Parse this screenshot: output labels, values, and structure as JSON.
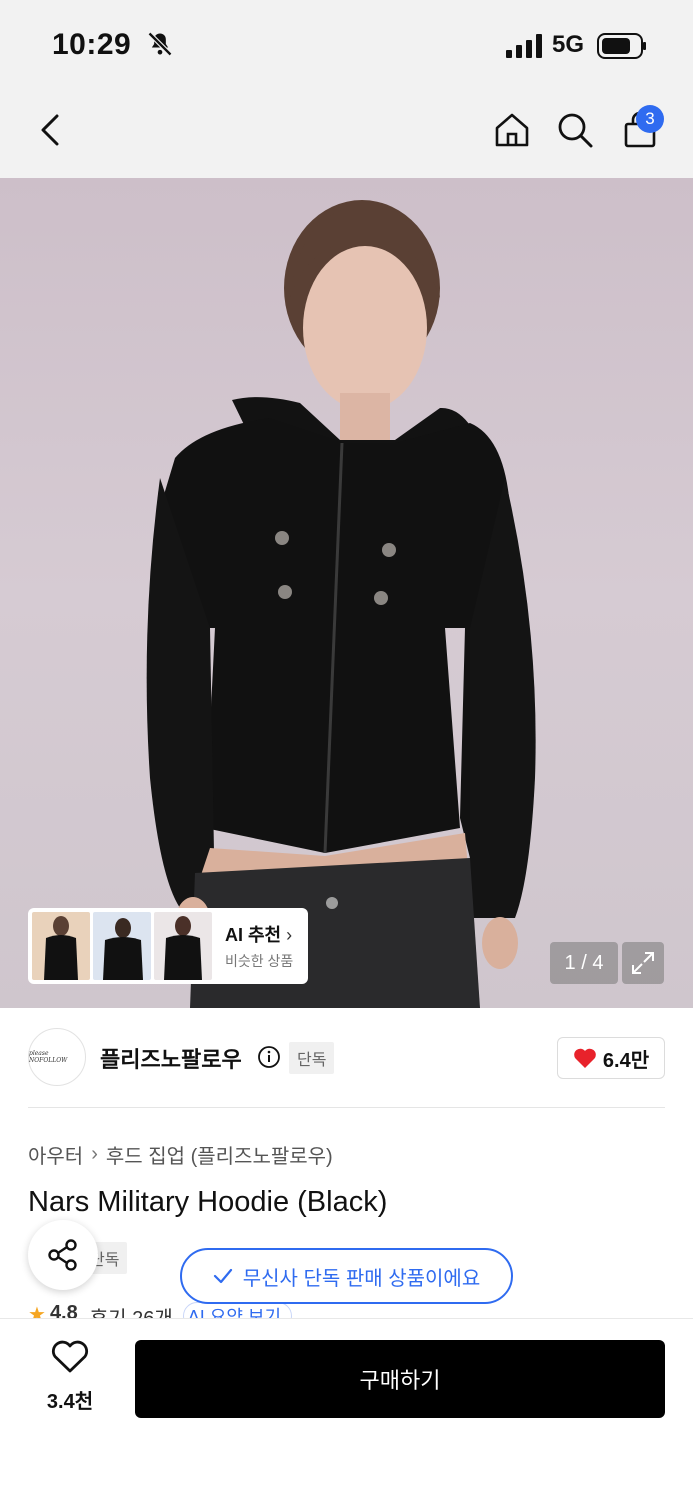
{
  "status_bar": {
    "time": "10:29",
    "network": "5G"
  },
  "nav": {
    "cart_count": "3"
  },
  "hero": {
    "image_counter": "1 / 4"
  },
  "ai_recommend": {
    "title": "AI 추천",
    "subtitle": "비슷한 상품"
  },
  "brand": {
    "name": "플리즈노팔로우",
    "tag": "단독",
    "likes": "6.4만",
    "logo_text": "please NOFOLLOW"
  },
  "breadcrumb": {
    "category": "아우터",
    "subcategory": "후드 집업 (플리즈노팔로우)"
  },
  "product": {
    "title": "Nars Military Hoodie (Black)",
    "tag": "단독"
  },
  "rating": {
    "score": "4.8",
    "reviews": "후기 26개",
    "ai_summary": "AI 요약 보기"
  },
  "toast": {
    "exclusive_message": "무신사 단독 판매 상품이에요"
  },
  "footer": {
    "wish_count": "3.4천",
    "buy_label": "구매하기"
  },
  "colors": {
    "accent_blue": "#2f6bf0",
    "heart_red": "#e8222b",
    "button_black": "#000000"
  }
}
